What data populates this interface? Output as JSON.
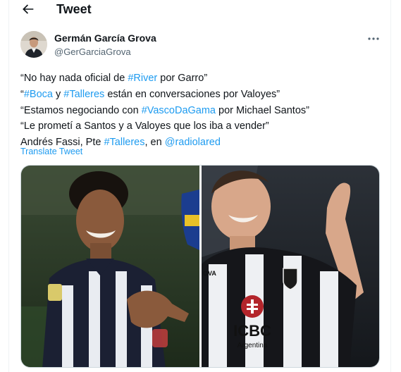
{
  "header": {
    "title": "Tweet",
    "back_icon": "arrow-left-icon"
  },
  "author": {
    "name": "Germán García Grova",
    "handle": "@GerGarciaGrova",
    "more_icon": "more-horizontal-icon"
  },
  "tweet": {
    "lines": [
      {
        "parts": [
          {
            "text": "“No hay nada oficial de "
          },
          {
            "text": "#River",
            "tag": true
          },
          {
            "text": " por Garro”"
          }
        ]
      },
      {
        "parts": [
          {
            "text": "“"
          },
          {
            "text": "#Boca",
            "tag": true
          },
          {
            "text": " y "
          },
          {
            "text": "#Talleres",
            "tag": true
          },
          {
            "text": " están en conversaciones por Valoyes”"
          }
        ]
      },
      {
        "parts": [
          {
            "text": "“Estamos negociando con "
          },
          {
            "text": "#VascoDaGama",
            "tag": true
          },
          {
            "text": " por Michael Santos”"
          }
        ]
      },
      {
        "parts": [
          {
            "text": "“Le prometí a Santos y a Valoyes que los iba a vender”"
          }
        ]
      },
      {
        "parts": [
          {
            "text": "Andrés Fassi, Pte "
          },
          {
            "text": "#Talleres",
            "tag": true
          },
          {
            "text": ", en "
          },
          {
            "text": "@radiolared",
            "tag": true
          }
        ]
      }
    ],
    "translate_label": "Translate Tweet"
  },
  "media": {
    "right_photo": {
      "jersey_brand": "ICBC",
      "jersey_sub": "Argentina",
      "sleeve_text": "OVA"
    }
  },
  "colors": {
    "link": "#1d9bf0",
    "text": "#0f1419",
    "secondary": "#536471",
    "border": "#cfd9de"
  }
}
